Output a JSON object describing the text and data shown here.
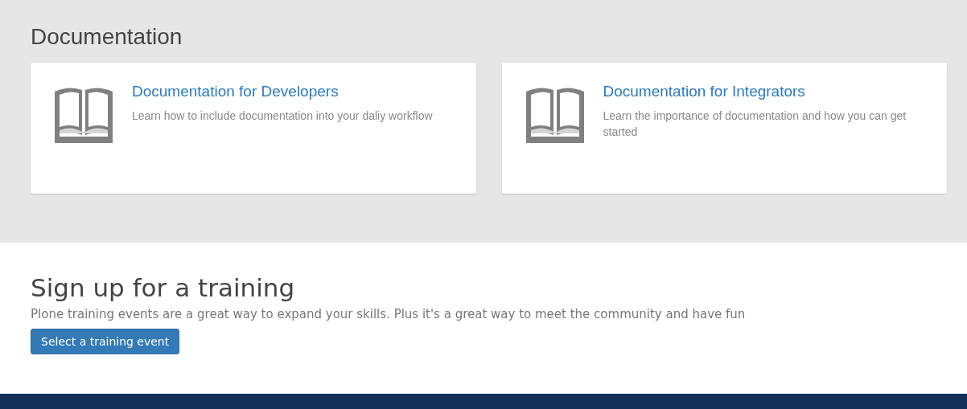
{
  "documentation": {
    "title": "Documentation",
    "cards": [
      {
        "title": "Documentation for Developers",
        "description": "Learn how to include documentation into your daliy workflow"
      },
      {
        "title": "Documentation for Integrators",
        "description": "Learn the importance of documentation and how you can get started"
      }
    ]
  },
  "training": {
    "title": "Sign up for a training",
    "description": "Plone training events are a great way to expand your skills. Plus it's a great way to meet the community and have fun",
    "button": "Select a training event"
  }
}
